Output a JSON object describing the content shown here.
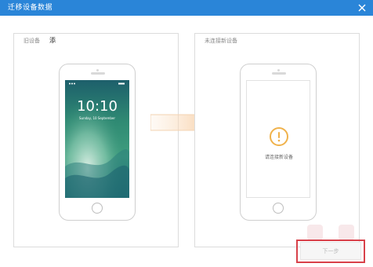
{
  "window": {
    "title": "迁移设备数据",
    "close_icon": "close-icon"
  },
  "left_panel": {
    "label": "旧设备",
    "value": "添",
    "lock_time": "10:10",
    "lock_date": "Sunday, 10 September"
  },
  "right_panel": {
    "label": "未连接新设备",
    "warning_icon": "exclamation-icon",
    "warning_text": "请连接新设备"
  },
  "arrow": {
    "icon": "right-arrow-icon"
  },
  "footer": {
    "next_label": "下一步"
  },
  "colors": {
    "titlebar": "#2a85d8",
    "warning": "#f0b24b",
    "highlight": "#d8414a"
  }
}
